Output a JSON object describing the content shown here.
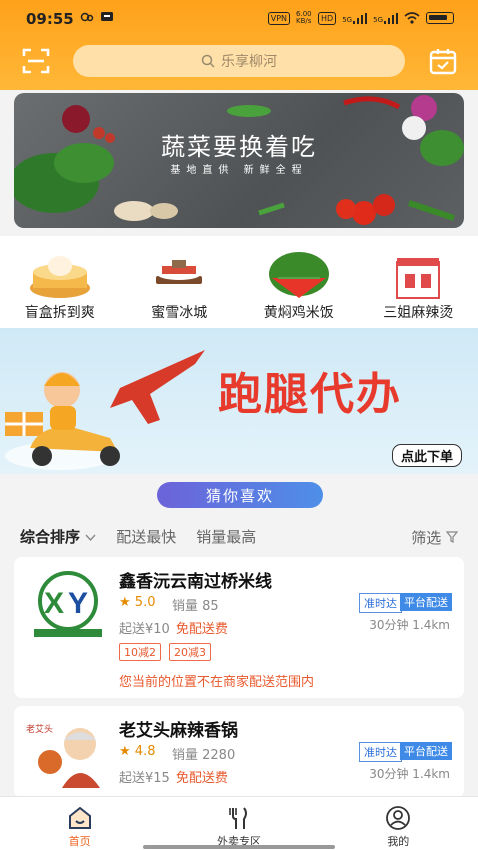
{
  "status_bar": {
    "time": "09:55",
    "vpn": "VPN",
    "net_speed": "6.00\nKB/s",
    "hd": "HD",
    "sig1": "5G",
    "sig2": "5G"
  },
  "header": {
    "search_placeholder": "乐享柳河"
  },
  "banner": {
    "title": "蔬菜要换着吃",
    "subtitle": "基地直供 新鲜全程"
  },
  "categories": [
    {
      "label": "盲盒拆到爽"
    },
    {
      "label": "蜜雪冰城"
    },
    {
      "label": "黄焖鸡米饭"
    },
    {
      "label": "三姐麻辣烫"
    }
  ],
  "errand": {
    "title": "跑腿代办",
    "order_button": "点此下单"
  },
  "guess": {
    "label": "猜你喜欢"
  },
  "sort": {
    "items": [
      "综合排序",
      "配送最快",
      "销量最高"
    ],
    "filter": "筛选"
  },
  "shops": [
    {
      "name": "鑫香沅云南过桥米线",
      "rating": "5.0",
      "sales": "销量 85",
      "tag1": "准时达",
      "tag2": "平台配送",
      "min_order": "起送¥10",
      "free_delivery": "免配送费",
      "time_distance": "30分钟 1.4km",
      "promos": [
        "10减2",
        "20减3"
      ],
      "notice": "您当前的位置不在商家配送范围内"
    },
    {
      "name": "老艾头麻辣香锅",
      "rating": "4.8",
      "sales": "销量 2280",
      "tag1": "准时达",
      "tag2": "平台配送",
      "min_order": "起送¥15",
      "free_delivery": "免配送费",
      "time_distance": "30分钟 1.4km"
    }
  ],
  "bottom_nav": [
    {
      "label": "首页"
    },
    {
      "label": "外卖专区"
    },
    {
      "label": "我的"
    }
  ],
  "colors": {
    "brand": "#ffa11a",
    "accent": "#f0641f",
    "blue": "#3e8ae6"
  }
}
